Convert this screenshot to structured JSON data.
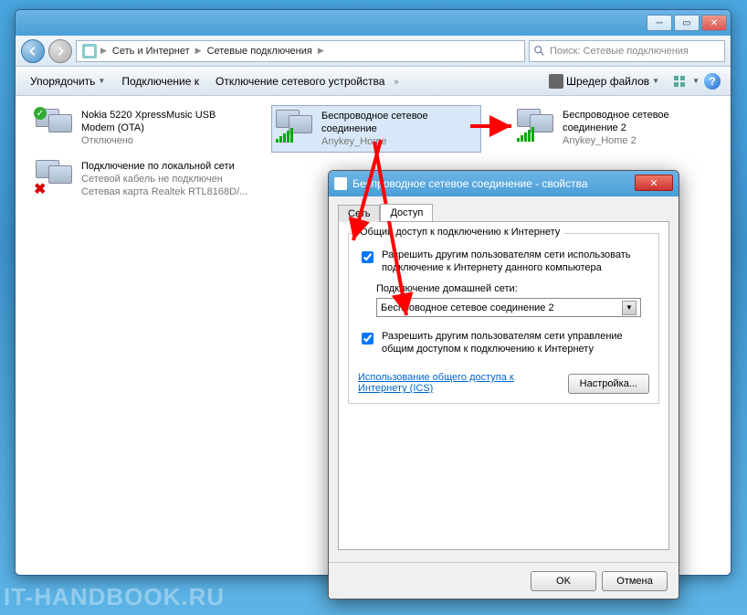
{
  "breadcrumb": {
    "part1": "Сеть и Интернет",
    "part2": "Сетевые подключения"
  },
  "search": {
    "placeholder": "Поиск: Сетевые подключения"
  },
  "toolbar": {
    "organize": "Упорядочить",
    "connect": "Подключение к",
    "disable": "Отключение сетевого устройства",
    "shredder": "Шредер файлов"
  },
  "connections": {
    "modem": {
      "l1": "Nokia 5220 XpressMusic USB",
      "l2": "Modem (OTA)",
      "l3": "Отключено"
    },
    "wifi1": {
      "l1": "Беспроводное сетевое",
      "l2": "соединение",
      "l3": "Anykey_Home"
    },
    "wifi2": {
      "l1": "Беспроводное сетевое",
      "l2": "соединение 2",
      "l3": "Anykey_Home 2"
    },
    "lan": {
      "l1": "Подключение по локальной сети",
      "l2": "Сетевой кабель не подключен",
      "l3": "Сетевая карта Realtek RTL8168D/..."
    }
  },
  "dialog": {
    "title": "Беспроводное сетевое соединение - свойства",
    "tab_net": "Сеть",
    "tab_share": "Доступ",
    "group_title": "Общий доступ к подключению к Интернету",
    "chk1": "Разрешить другим пользователям сети использовать подключение к Интернету данного компьютера",
    "home_label": "Подключение домашней сети:",
    "home_value": "Беспроводное сетевое соединение 2",
    "chk2": "Разрешить другим пользователям сети управление общим доступом к подключению к Интернету",
    "ics_link": "Использование общего доступа к Интернету (ICS)",
    "settings_btn": "Настройка...",
    "ok": "OK",
    "cancel": "Отмена"
  },
  "watermark": "IT-HANDBOOK.RU"
}
